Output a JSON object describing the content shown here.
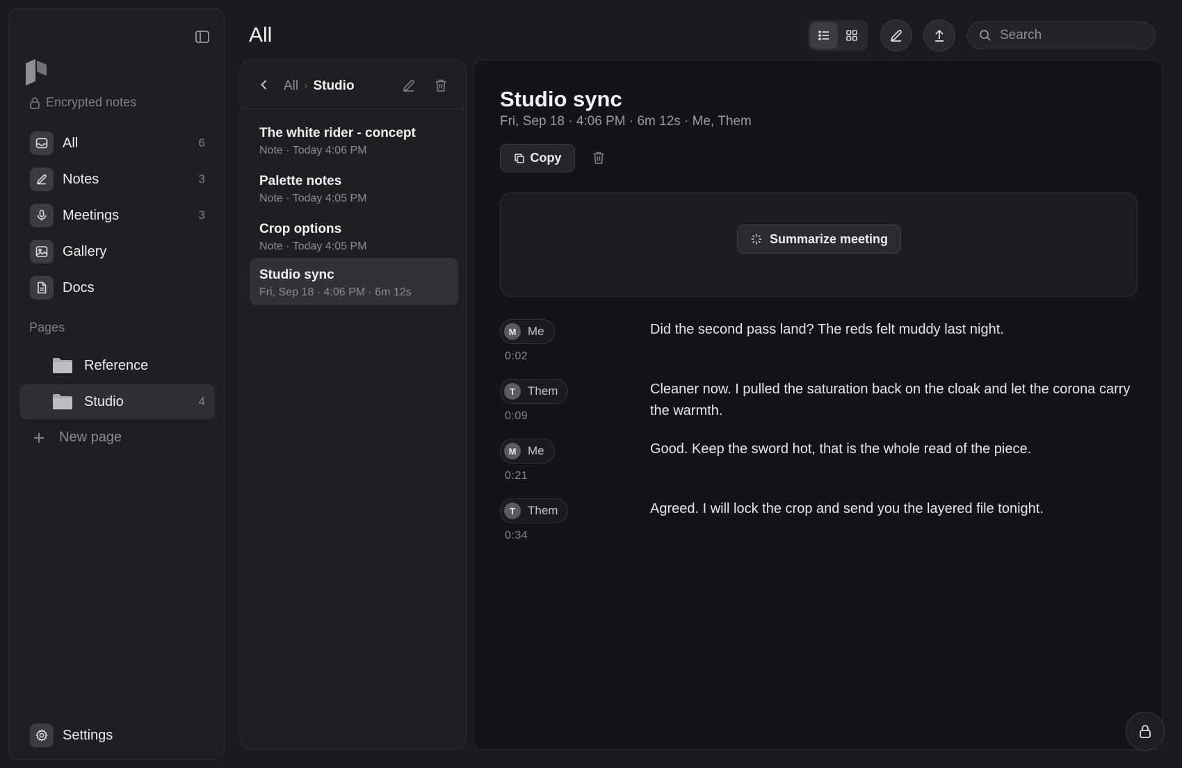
{
  "header": {
    "title": "All",
    "search_placeholder": "Search",
    "view_modes": [
      "list",
      "grid"
    ],
    "active_view": "list"
  },
  "sidebar": {
    "section_encrypted": "Encrypted notes",
    "items": [
      {
        "label": "All",
        "count": "6",
        "icon": "inbox-icon"
      },
      {
        "label": "Notes",
        "count": "3",
        "icon": "pencil-icon"
      },
      {
        "label": "Meetings",
        "count": "3",
        "icon": "microphone-icon"
      },
      {
        "label": "Gallery",
        "count": "",
        "icon": "image-icon"
      },
      {
        "label": "Docs",
        "count": "",
        "icon": "document-icon"
      }
    ],
    "section_pages": "Pages",
    "pages": [
      {
        "label": "Reference",
        "count": ""
      },
      {
        "label": "Studio",
        "count": "4",
        "active": true
      }
    ],
    "new_page_label": "New page",
    "settings_label": "Settings"
  },
  "list": {
    "breadcrumb_root": "All",
    "breadcrumb_separator": "›",
    "breadcrumb_current": "Studio",
    "notes": [
      {
        "title": "The white rider - concept",
        "meta": "Note · Today 4:06 PM"
      },
      {
        "title": "Palette notes",
        "meta": "Note · Today 4:05 PM"
      },
      {
        "title": "Crop options",
        "meta": "Note · Today 4:05 PM"
      },
      {
        "title": "Studio sync",
        "meta": "Fri, Sep 18 · 4:06 PM · 6m 12s",
        "active": true
      }
    ]
  },
  "detail": {
    "title": "Studio sync",
    "meta": "Fri, Sep 18 · 4:06 PM · 6m 12s · Me, Them",
    "copy_label": "Copy",
    "summarize_label": "Summarize meeting",
    "transcript": [
      {
        "initial": "M",
        "speaker": "Me",
        "time": "0:02",
        "text": "Did the second pass land? The reds felt muddy last night."
      },
      {
        "initial": "T",
        "speaker": "Them",
        "time": "0:09",
        "text": "Cleaner now. I pulled the saturation back on the cloak and let the corona carry the warmth."
      },
      {
        "initial": "M",
        "speaker": "Me",
        "time": "0:21",
        "text": "Good. Keep the sword hot, that is the whole read of the piece."
      },
      {
        "initial": "T",
        "speaker": "Them",
        "time": "0:34",
        "text": "Agreed. I will lock the crop and send you the layered file tonight."
      }
    ]
  },
  "colors": {
    "background": "#1b1b1e",
    "panel": "#1f1f22",
    "detail_panel": "#141418",
    "active_item": "#2f2f33"
  }
}
